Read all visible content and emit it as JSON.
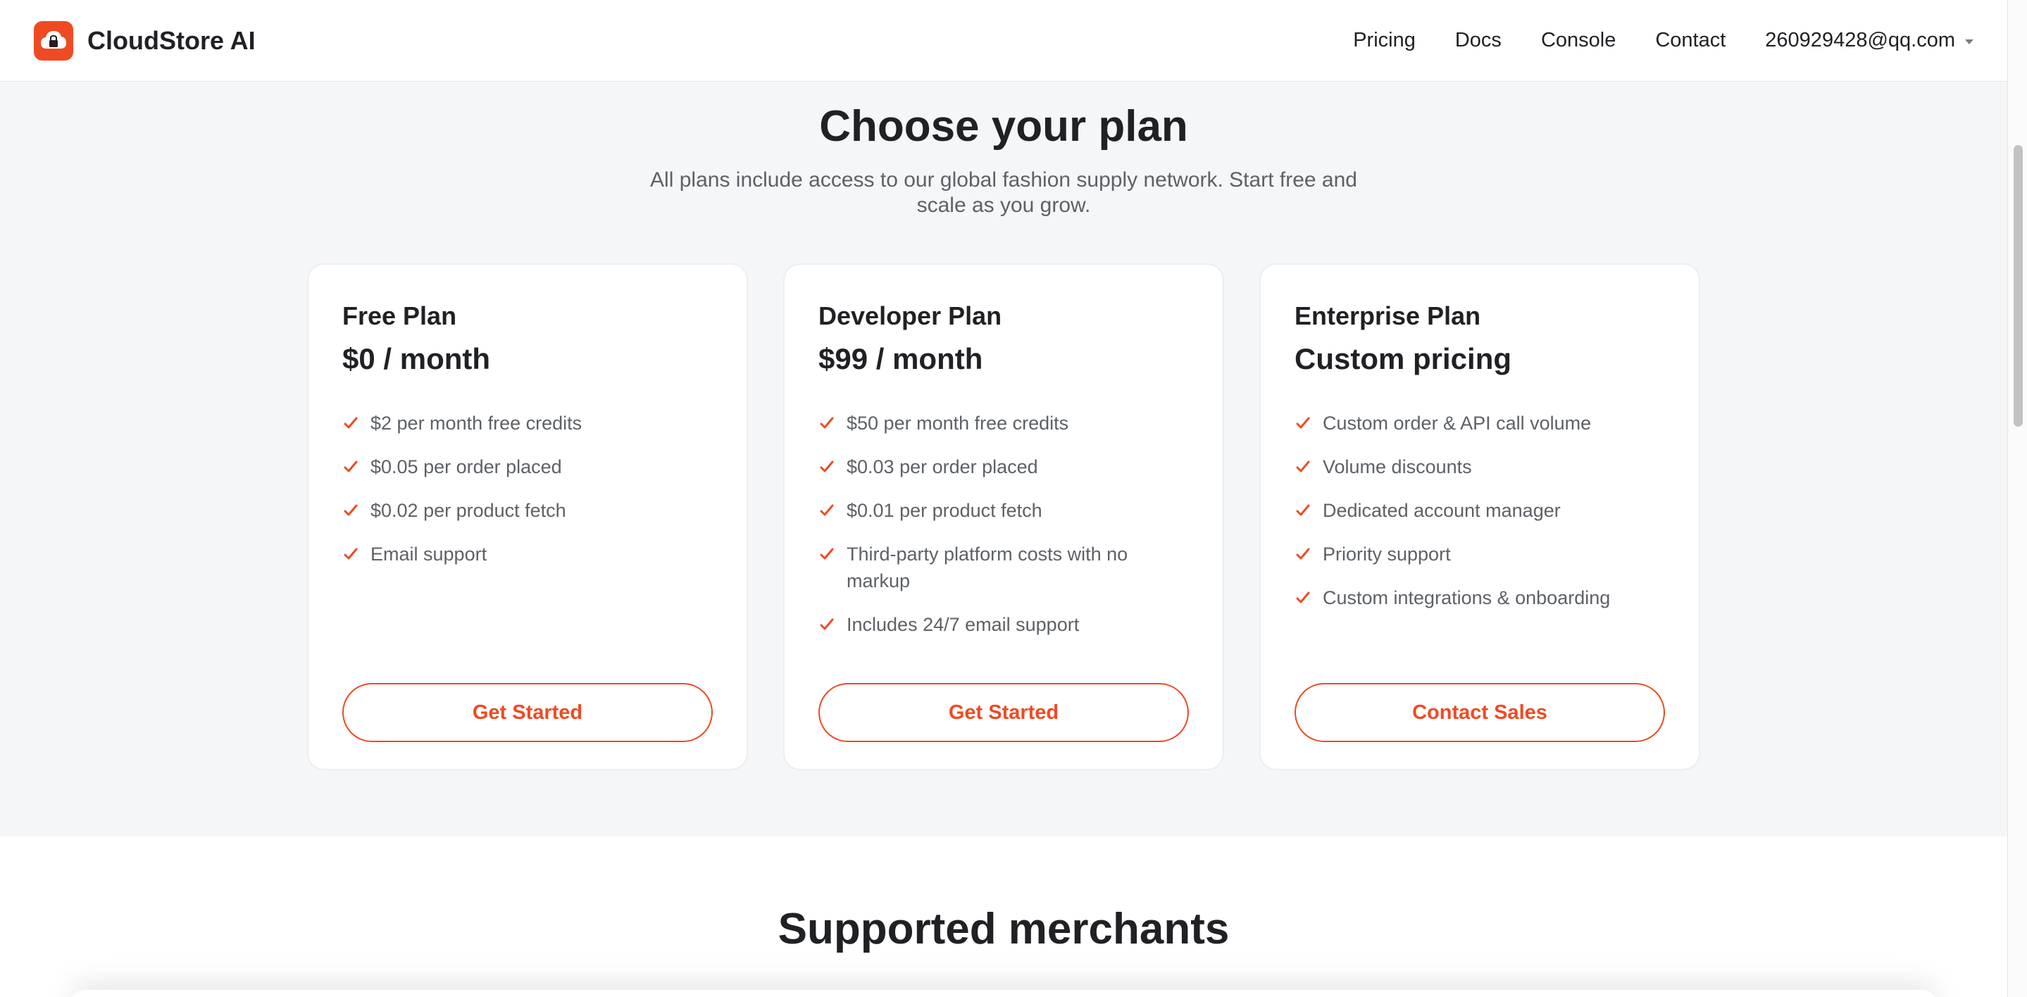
{
  "brand": {
    "name": "CloudStore AI",
    "logo_icon": "cloud-lock-icon",
    "accent_color": "#ef4a23"
  },
  "nav": {
    "items": [
      "Pricing",
      "Docs",
      "Console",
      "Contact"
    ],
    "account_email": "260929428@qq.com"
  },
  "pricing": {
    "title": "Choose your plan",
    "subtitle": "All plans include access to our global fashion supply network. Start free and scale as you grow.",
    "plans": [
      {
        "name": "Free Plan",
        "price": "$0 / month",
        "features": [
          "$2 per month free credits",
          "$0.05 per order placed",
          "$0.02 per product fetch",
          "Email support"
        ],
        "cta": "Get Started"
      },
      {
        "name": "Developer Plan",
        "price": "$99 / month",
        "features": [
          "$50 per month free credits",
          "$0.03 per order placed",
          "$0.01 per product fetch",
          "Third-party platform costs with no markup",
          "Includes 24/7 email support"
        ],
        "cta": "Get Started"
      },
      {
        "name": "Enterprise Plan",
        "price": "Custom pricing",
        "features": [
          "Custom order & API call volume",
          "Volume discounts",
          "Dedicated account manager",
          "Priority support",
          "Custom integrations & onboarding"
        ],
        "cta": "Contact Sales"
      }
    ]
  },
  "merchants": {
    "title": "Supported merchants"
  }
}
